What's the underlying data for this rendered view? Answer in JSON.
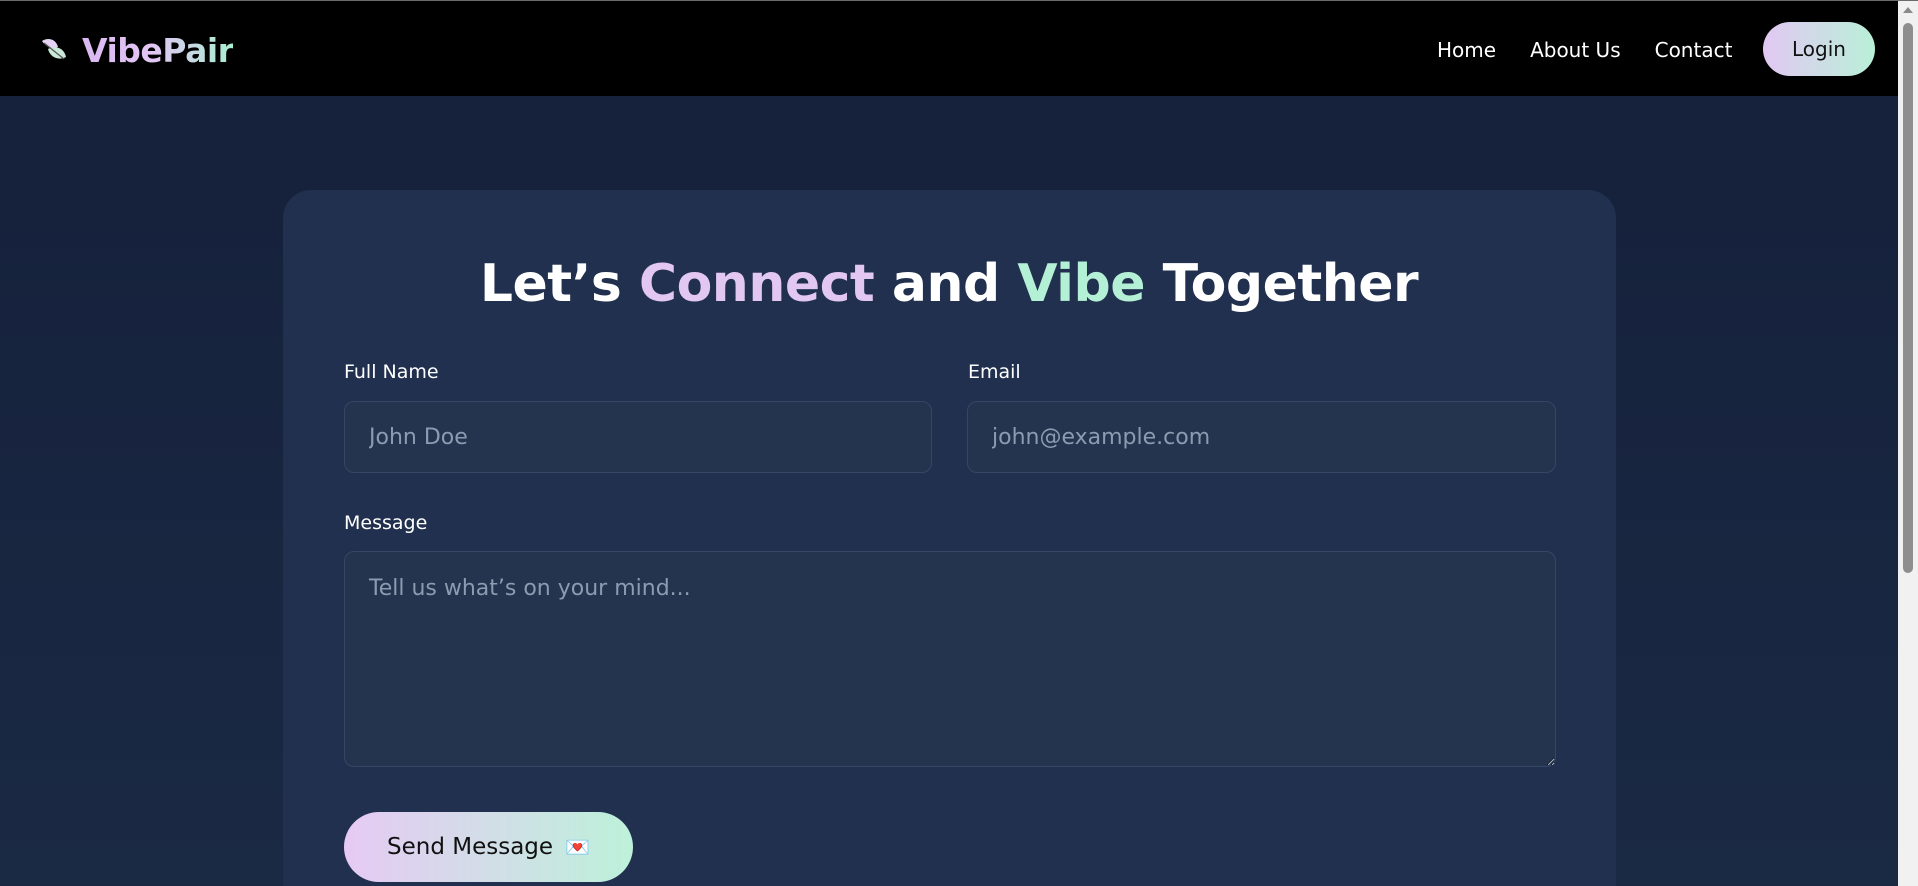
{
  "brand": {
    "name": "VibePair",
    "icon": "leaf-icon"
  },
  "nav": {
    "links": [
      "Home",
      "About Us",
      "Contact"
    ],
    "login_label": "Login"
  },
  "contact": {
    "heading": {
      "part1": "Let’s ",
      "highlight1": "Connect",
      "part2": " and ",
      "highlight2": "Vibe",
      "part3": " Together"
    },
    "full_name": {
      "label": "Full Name",
      "placeholder": "John Doe",
      "value": ""
    },
    "email": {
      "label": "Email",
      "placeholder": "john@example.com",
      "value": ""
    },
    "message": {
      "label": "Message",
      "placeholder": "Tell us what’s on your mind...",
      "value": ""
    },
    "submit": {
      "label": "Send Message",
      "icon": "love-letter-icon",
      "icon_glyph": "💌"
    }
  },
  "colors": {
    "accent_purple": "#e2c7f3",
    "accent_green": "#b4f0d6",
    "nav_bg": "#000000",
    "page_bg": "#1a2944",
    "card_bg": "#21304e"
  }
}
